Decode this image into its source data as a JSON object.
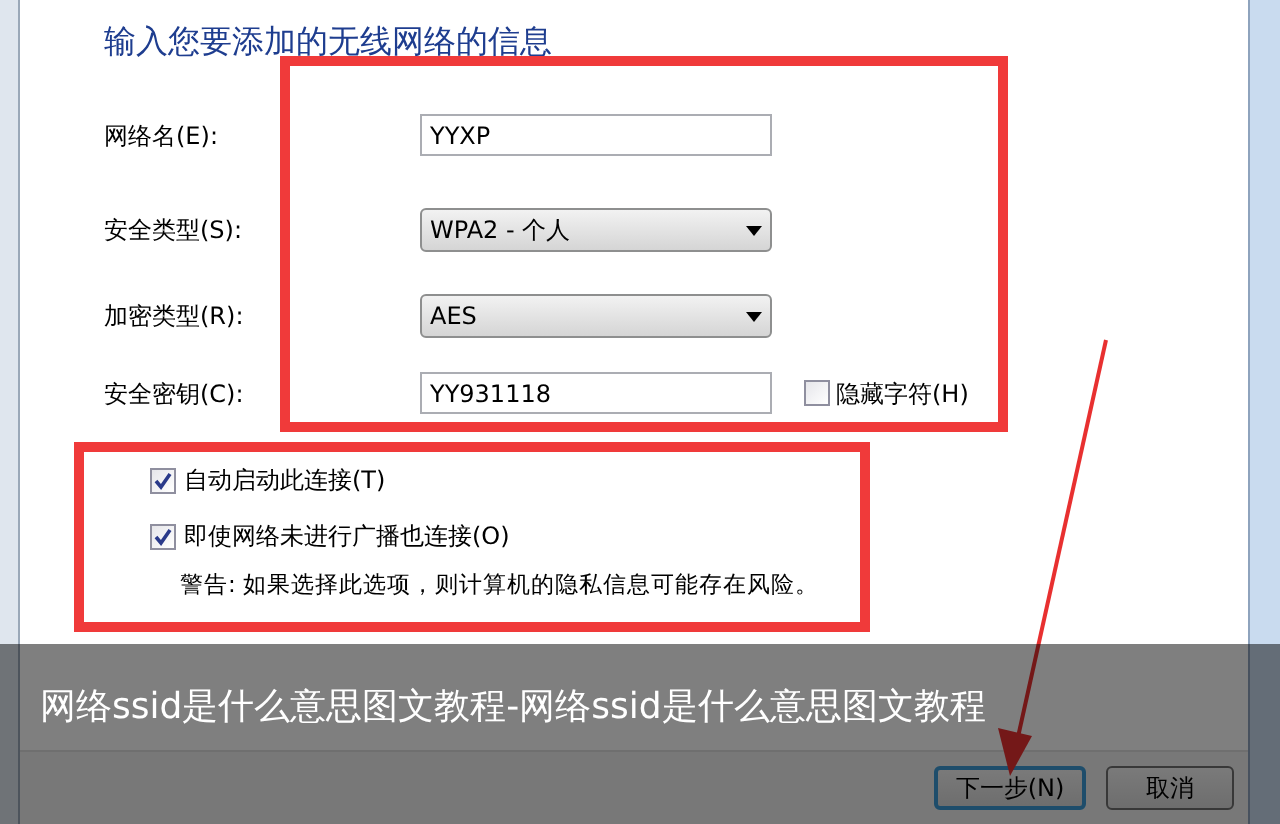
{
  "dialog": {
    "heading": "输入您要添加的无线网络的信息",
    "fields": [
      {
        "kind": "text",
        "label": "网络名(E):",
        "value": "YYXP"
      },
      {
        "kind": "dropdown",
        "label": "安全类型(S):",
        "value": "WPA2 - 个人"
      },
      {
        "kind": "dropdown",
        "label": "加密类型(R):",
        "value": "AES"
      },
      {
        "kind": "text",
        "label": "安全密钥(C):",
        "value": "YY931118",
        "option": {
          "label": "隐藏字符(H)",
          "checked": false
        }
      }
    ],
    "options": [
      {
        "label": "自动启动此连接(T)",
        "checked": true
      },
      {
        "label": "即使网络未进行广播也连接(O)",
        "checked": true,
        "warning": "警告: 如果选择此选项，则计算机的隐私信息可能存在风险。"
      }
    ],
    "buttons": [
      {
        "label": "下一步(N)",
        "focused": true
      },
      {
        "label": "取消",
        "focused": false
      }
    ]
  },
  "caption": "网络ssid是什么意思图文教程-网络ssid是什么意思图文教程"
}
